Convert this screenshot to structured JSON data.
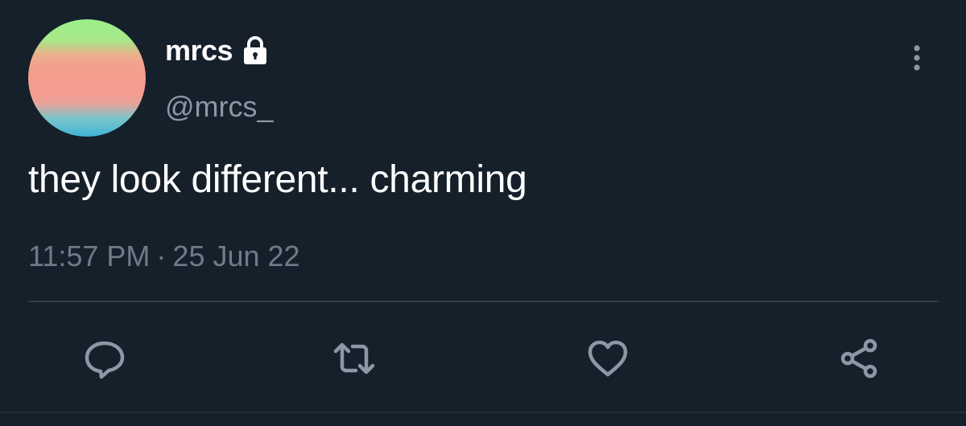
{
  "user": {
    "display_name": "mrcs",
    "handle": "@mrcs_",
    "protected_icon": "lock-icon",
    "avatar": "gradient-avatar"
  },
  "tweet": {
    "text": "they look different... charming",
    "time": "11:57 PM",
    "separator": "·",
    "date": "25 Jun 22"
  },
  "actions": {
    "reply": "reply-icon",
    "retweet": "retweet-icon",
    "like": "heart-icon",
    "share": "share-icon",
    "more": "more-vertical-icon"
  },
  "colors": {
    "background": "#15202b",
    "text_primary": "#ffffff",
    "text_secondary": "#8b98a5",
    "icon": "#8b98a5"
  }
}
